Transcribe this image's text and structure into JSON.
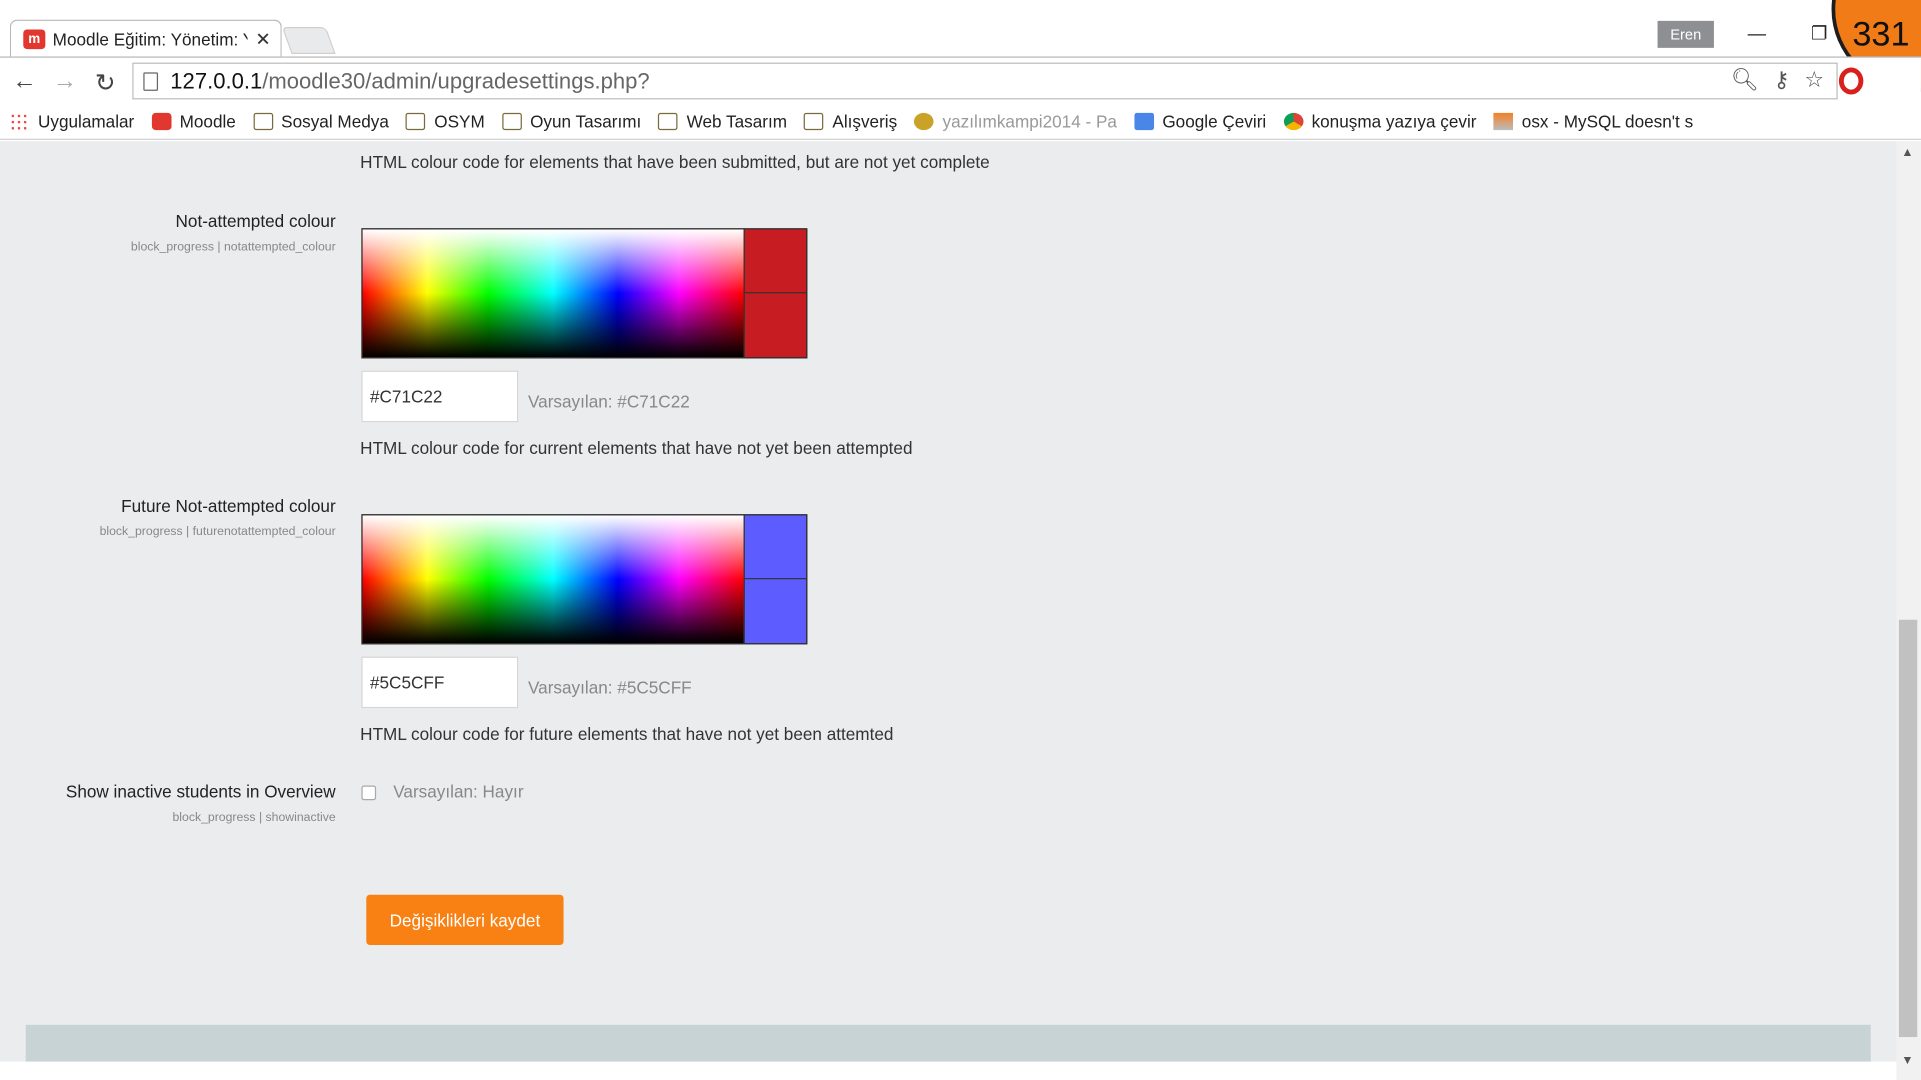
{
  "browser": {
    "tab_title": "Moodle Eğitim: Yönetim: Y",
    "tab_favicon": "m",
    "profile_name": "Eren",
    "url_host": "127.0.0.1",
    "url_path": "/moodle30/admin/upgradesettings.php?",
    "badge_number": "331",
    "bookmarks": [
      {
        "label": "Uygulamalar",
        "icon": "apps-icon"
      },
      {
        "label": "Moodle",
        "icon": "moodle-icon"
      },
      {
        "label": "Sosyal Medya",
        "icon": "folder-icon"
      },
      {
        "label": "OSYM",
        "icon": "folder-icon"
      },
      {
        "label": "Oyun Tasarımı",
        "icon": "folder-icon"
      },
      {
        "label": "Web Tasarım",
        "icon": "folder-icon"
      },
      {
        "label": "Alışveriş",
        "icon": "folder-icon"
      },
      {
        "label": "yazılımkampi2014 - Pa",
        "icon": "cat-icon"
      },
      {
        "label": "Google Çeviri",
        "icon": "google-translate-icon"
      },
      {
        "label": "konuşma yazıya çevir",
        "icon": "chrome-icon"
      },
      {
        "label": "osx - MySQL doesn't s",
        "icon": "stackoverflow-icon"
      }
    ]
  },
  "settings": {
    "top_description": "HTML colour code for elements that have been submitted, but are not yet complete",
    "not_attempted": {
      "label": "Not-attempted colour",
      "sublabel": "block_progress | notattempted_colour",
      "value": "#C71C22",
      "color": "#C71C22",
      "default": "Varsayılan: #C71C22",
      "description": "HTML colour code for current elements that have not yet been attempted"
    },
    "future_not_attempted": {
      "label": "Future Not-attempted colour",
      "sublabel": "block_progress | futurenotattempted_colour",
      "value": "#5C5CFF",
      "color": "#5C5CFF",
      "default": "Varsayılan: #5C5CFF",
      "description": "HTML colour code for future elements that have not yet been attemted"
    },
    "show_inactive": {
      "label": "Show inactive students in Overview",
      "sublabel": "block_progress | showinactive",
      "default": "Varsayılan: Hayır",
      "checked": false
    },
    "save_button": "Değişiklikleri kaydet"
  },
  "colors": {
    "page_bg": "#eaeced",
    "button": "#f98012",
    "footer": "#c8d3d6"
  }
}
